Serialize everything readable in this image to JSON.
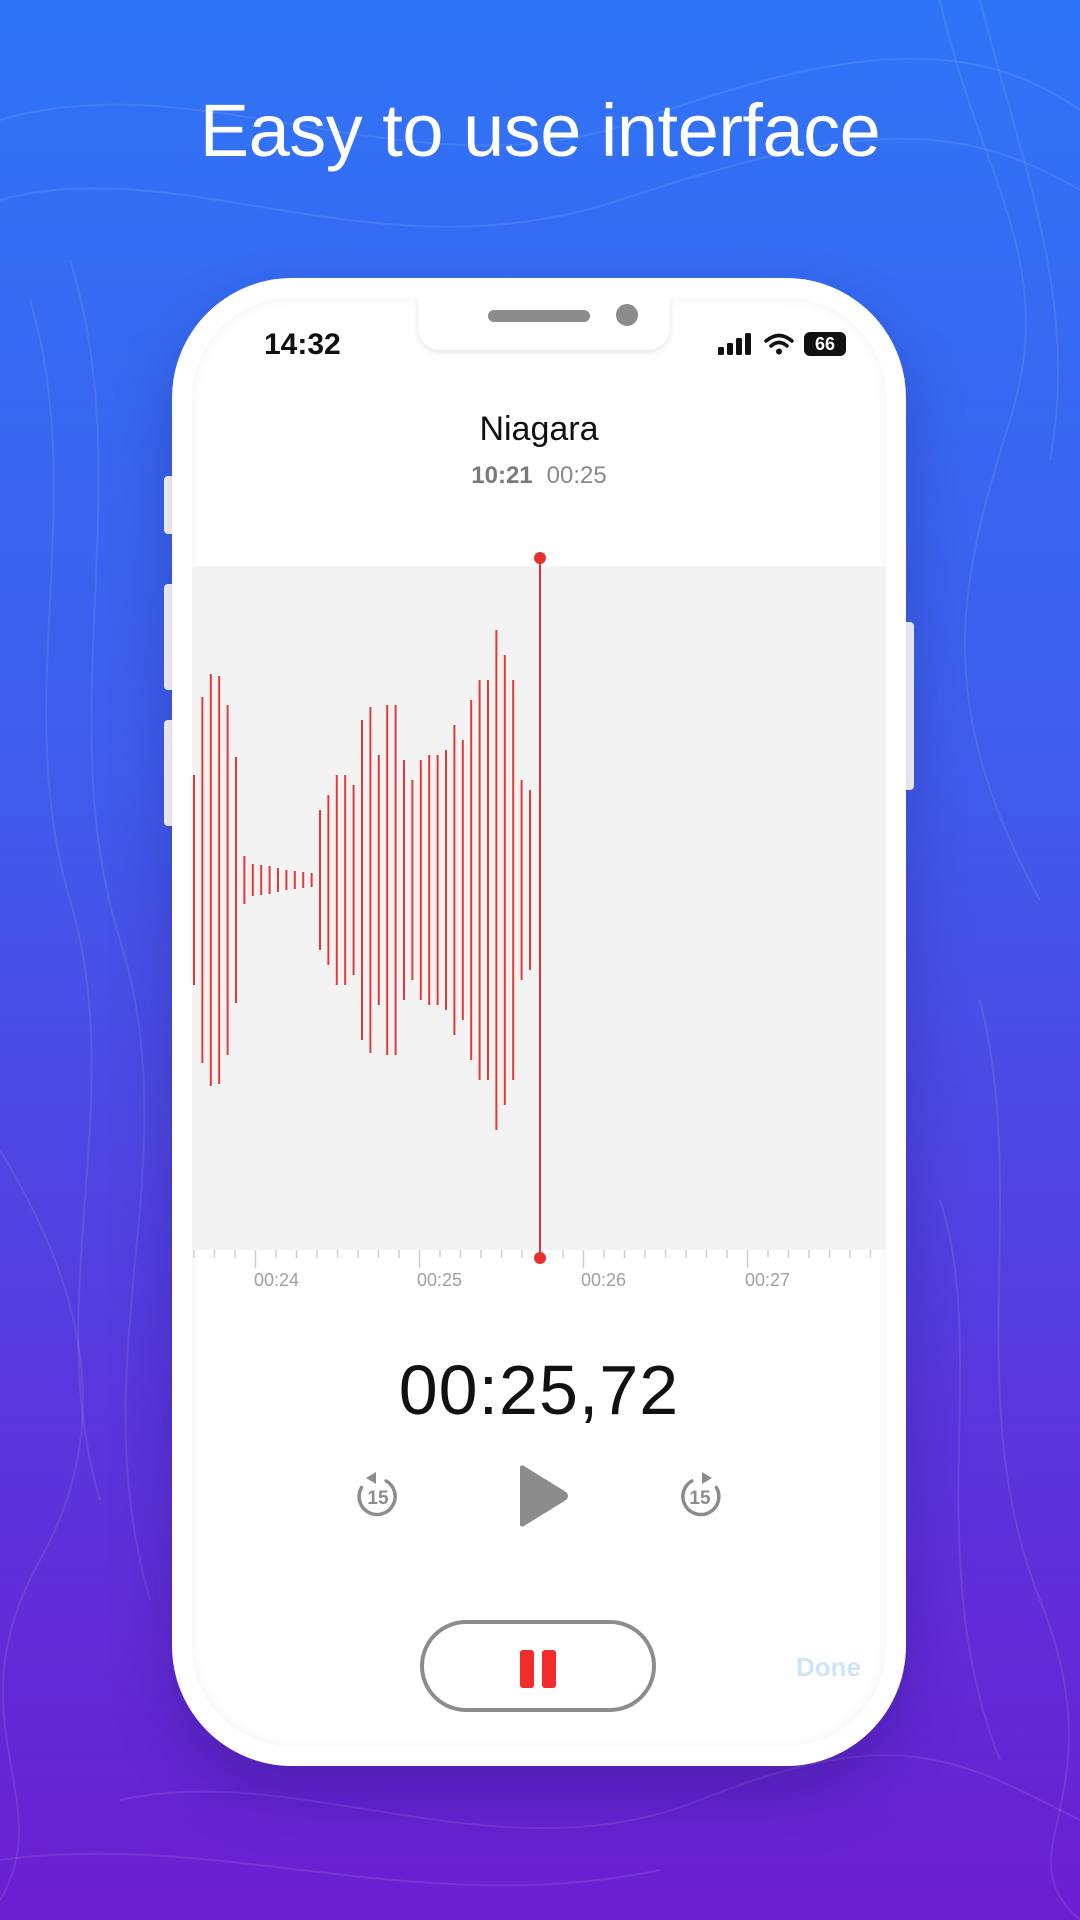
{
  "headline": "Easy to use interface",
  "colors": {
    "accent_red": "#f22b2b",
    "background_top": "#2f74f6",
    "background_bottom": "#6a1fd0",
    "done_text": "#cfe4fb"
  },
  "status_bar": {
    "time": "14:32",
    "battery": "66",
    "icons": [
      "signal-icon",
      "wifi-icon",
      "battery-icon"
    ]
  },
  "recording": {
    "title": "Niagara",
    "time_of_day": "10:21",
    "duration": "00:25"
  },
  "timeline": {
    "labels": [
      "00:24",
      "00:25",
      "00:26",
      "00:27"
    ]
  },
  "playback": {
    "elapsed": "00:25,72",
    "skip_back_seconds": "15",
    "skip_forward_seconds": "15"
  },
  "actions": {
    "done_label": "Done"
  }
}
